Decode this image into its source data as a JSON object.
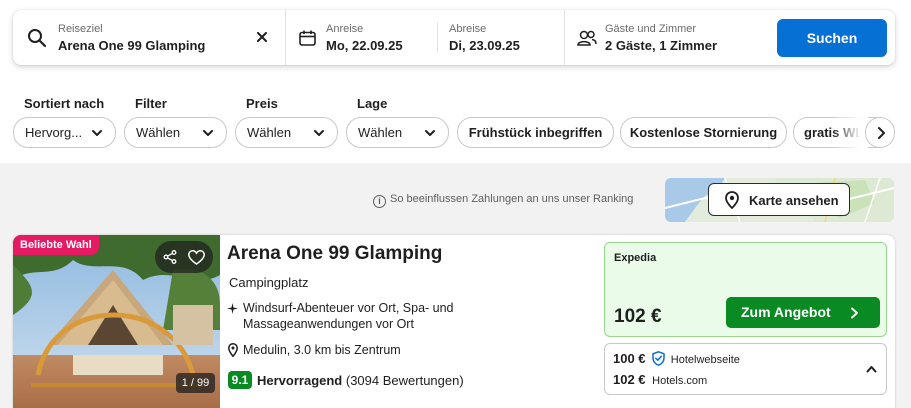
{
  "search": {
    "destination_label": "Reiseziel",
    "destination_value": "Arena One 99 Glamping",
    "checkin_label": "Anreise",
    "checkin_value": "Mo, 22.09.25",
    "checkout_label": "Abreise",
    "checkout_value": "Di, 23.09.25",
    "guests_label": "Gäste und Zimmer",
    "guests_value": "2 Gäste, 1 Zimmer",
    "search_button": "Suchen"
  },
  "filters": {
    "sort": {
      "label": "Sortiert nach",
      "value": "Hervorg..."
    },
    "filter": {
      "label": "Filter",
      "value": "Wählen"
    },
    "price": {
      "label": "Preis",
      "value": "Wählen"
    },
    "location": {
      "label": "Lage",
      "value": "Wählen"
    },
    "chips": [
      "Frühstück inbegriffen",
      "Kostenlose Stornierung",
      "gratis WLAN"
    ]
  },
  "ranking_notice": "So beeinflussen Zahlungen an uns unser Ranking",
  "map_button": "Karte ansehen",
  "hotel": {
    "badge": "Beliebte Wahl",
    "photo_counter": "1 / 99",
    "name": "Arena One 99 Glamping",
    "type": "Campingplatz",
    "feature": "Windsurf-Abenteuer vor Ort, Spa- und Massageanwendungen vor Ort",
    "location": "Medulin, 3.0 km bis Zentrum",
    "score": "9.1",
    "rating_word": "Hervorragend",
    "rating_count": "(3094 Bewertungen)",
    "deal": {
      "provider": "Expedia",
      "price": "102 €",
      "button": "Zum Angebot"
    },
    "other_offers": [
      {
        "price": "100 €",
        "source": "Hotelwebseite"
      },
      {
        "price": "102 €",
        "source": "Hotels.com"
      }
    ]
  },
  "colors": {
    "primary_blue": "#0770d5",
    "deal_green": "#0a8a22",
    "badge_pink": "#e51a63"
  }
}
